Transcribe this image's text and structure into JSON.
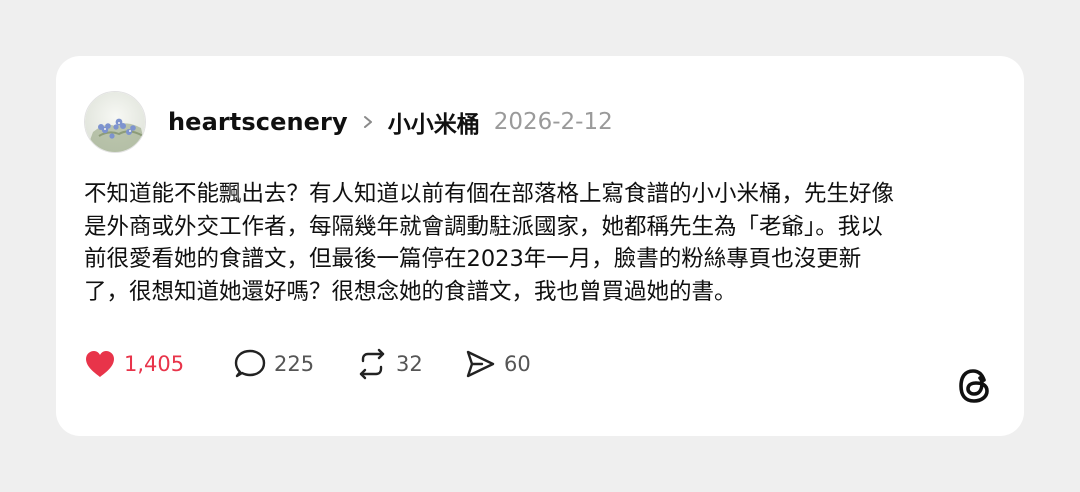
{
  "post": {
    "username": "heartscenery",
    "community": "小小米桶",
    "date": "2026-2-12",
    "text": "不知道能不能飄出去？有人知道以前有個在部落格上寫食譜的小小米桶，先生好像\n是外商或外交工作者，每隔幾年就會調動駐派國家，她都稱先生為「老爺」。我以\n前很愛看她的食譜文，但最後一篇停在2023年一月，臉書的粉絲專頁也沒更新\n了，很想知道她還好嗎？很想念她的食譜文，我也曾買過她的書。"
  },
  "actions": {
    "likes": "1,405",
    "replies": "225",
    "reposts": "32",
    "shares": "60"
  },
  "colors": {
    "like": "#e8344a",
    "text": "#101010",
    "muted": "#9a9a9a",
    "card": "#ffffff",
    "background": "#efefef"
  },
  "icons": {
    "like": "heart-icon",
    "reply": "speech-bubble-icon",
    "repost": "repost-icon",
    "share": "send-icon",
    "brand": "threads-logo",
    "separator": "chevron-right-icon"
  }
}
